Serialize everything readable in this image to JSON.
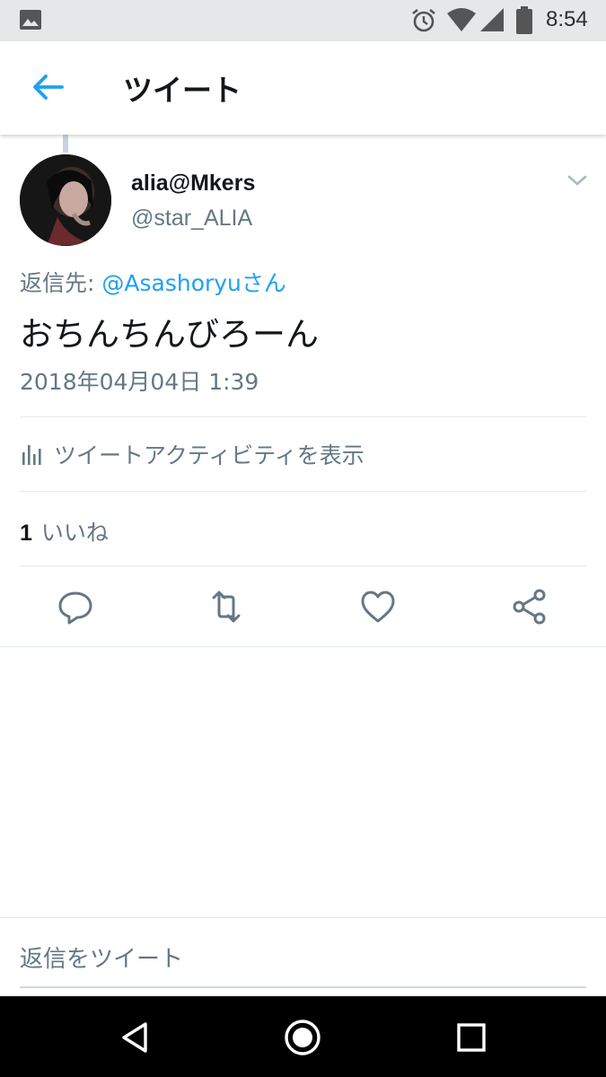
{
  "status_bar": {
    "time": "8:54",
    "icons": [
      "gallery-icon",
      "alarm-icon",
      "wifi-icon",
      "signal-icon",
      "battery-icon"
    ]
  },
  "header": {
    "title": "ツイート",
    "back_icon": "arrow-left-icon"
  },
  "tweet": {
    "display_name": "alia@Mkers",
    "handle": "@star_ALIA",
    "reply_to_prefix": "返信先: ",
    "reply_to_mention": "@Asashoryuさん",
    "text": "おちんちんびろーん",
    "timestamp": "2018年04月04日 1:39",
    "activity_label": "ツイートアクティビティを表示",
    "likes_count": "1",
    "likes_label": "いいね"
  },
  "actions": [
    "reply-icon",
    "retweet-icon",
    "like-icon",
    "share-icon"
  ],
  "reply_placeholder": "返信をツイート",
  "colors": {
    "accent": "#1da1f2",
    "secondary_text": "#657786",
    "primary_text": "#14171a",
    "divider": "#e1e8ed"
  }
}
